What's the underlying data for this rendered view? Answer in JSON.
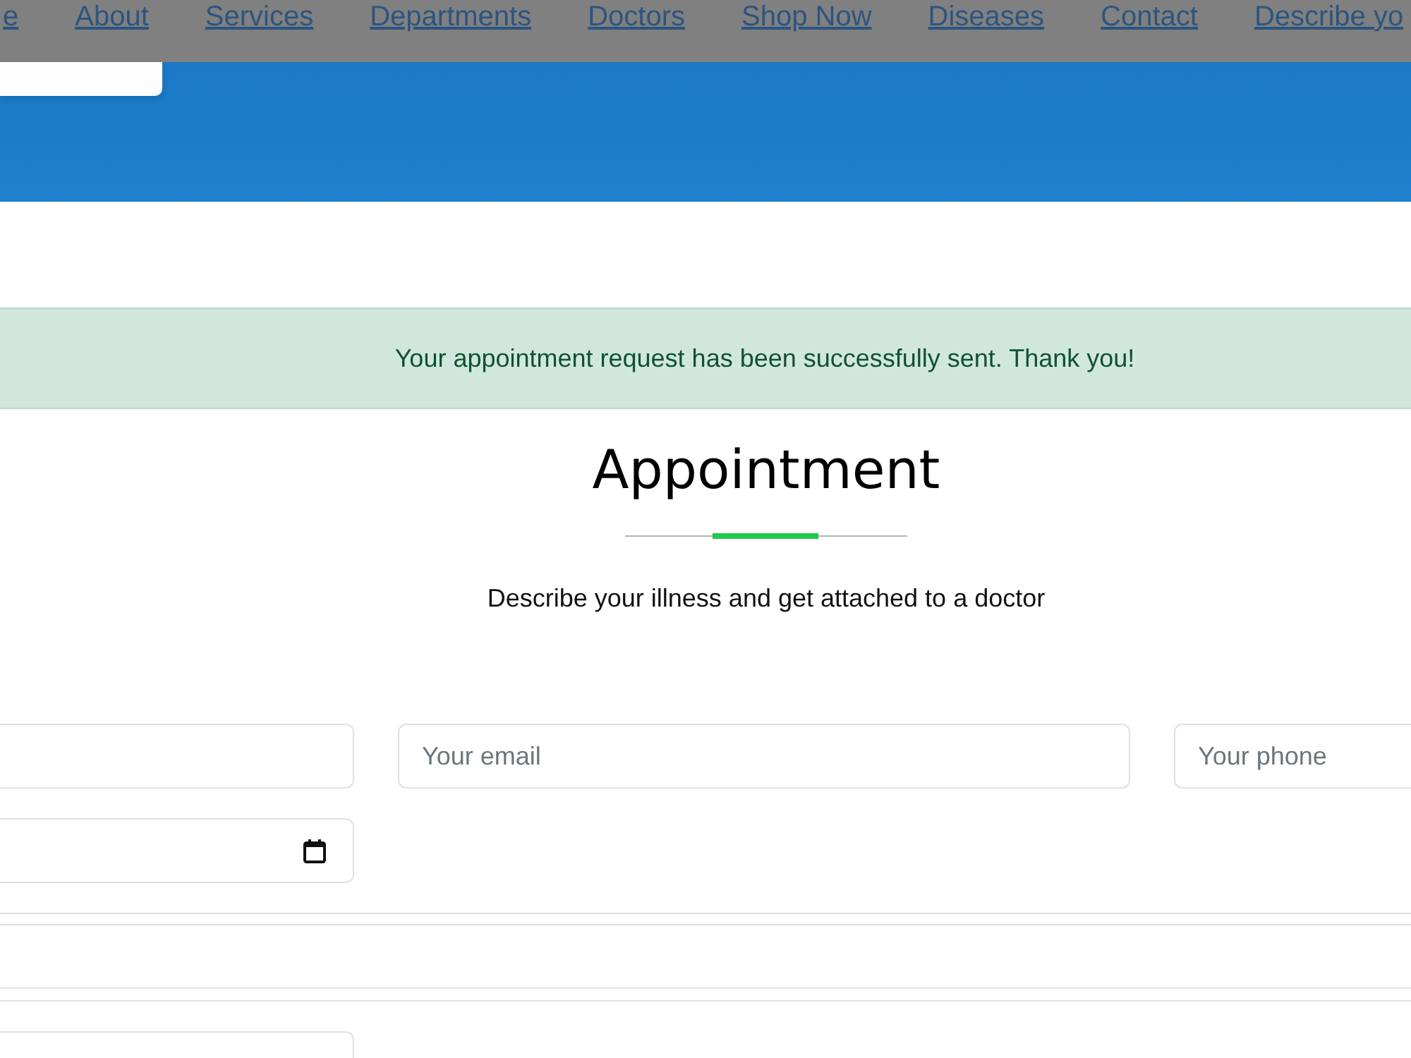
{
  "nav": {
    "links": [
      "e",
      "About",
      "Services",
      "Departments",
      "Doctors",
      "Shop Now",
      "Diseases",
      "Contact",
      "Describe yo"
    ]
  },
  "alert": {
    "text": "Your appointment request has been successfully sent. Thank you!"
  },
  "section": {
    "title": "Appointment",
    "subtitle": "Describe your illness and get attached to a doctor"
  },
  "form": {
    "rows": [
      {
        "fields": [
          {
            "kind": "text"
          },
          {
            "kind": "text",
            "placeholder": "Your email"
          },
          {
            "kind": "text",
            "placeholder": "Your phone"
          }
        ]
      },
      {
        "fields": [
          {
            "kind": "date"
          }
        ]
      },
      {
        "fields": [
          {
            "kind": "wide"
          }
        ]
      },
      {
        "fields": [
          {
            "kind": "text"
          }
        ]
      }
    ]
  }
}
